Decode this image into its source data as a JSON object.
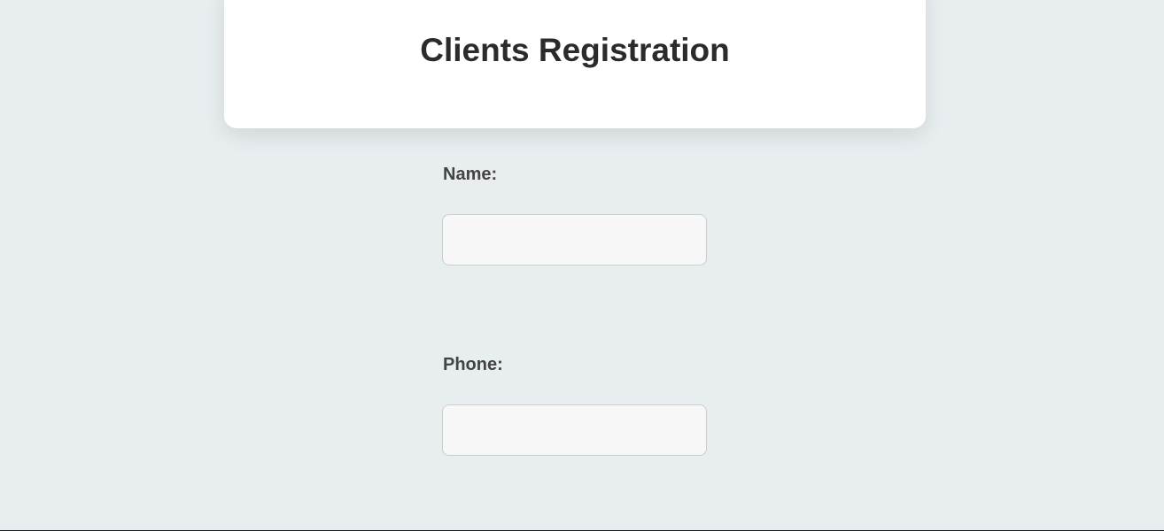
{
  "header": {
    "title": "Clients Registration"
  },
  "form": {
    "name_label": "Name:",
    "name_value": "",
    "name_placeholder": "",
    "phone_label": "Phone:",
    "phone_value": "",
    "phone_placeholder": ""
  },
  "colors": {
    "background": "#e8edf0",
    "card": "#ffffff",
    "title_text": "#2b2b2b",
    "label_text": "#444444",
    "input_background": "#f7f7f7",
    "input_border": "#c9cdd0"
  }
}
